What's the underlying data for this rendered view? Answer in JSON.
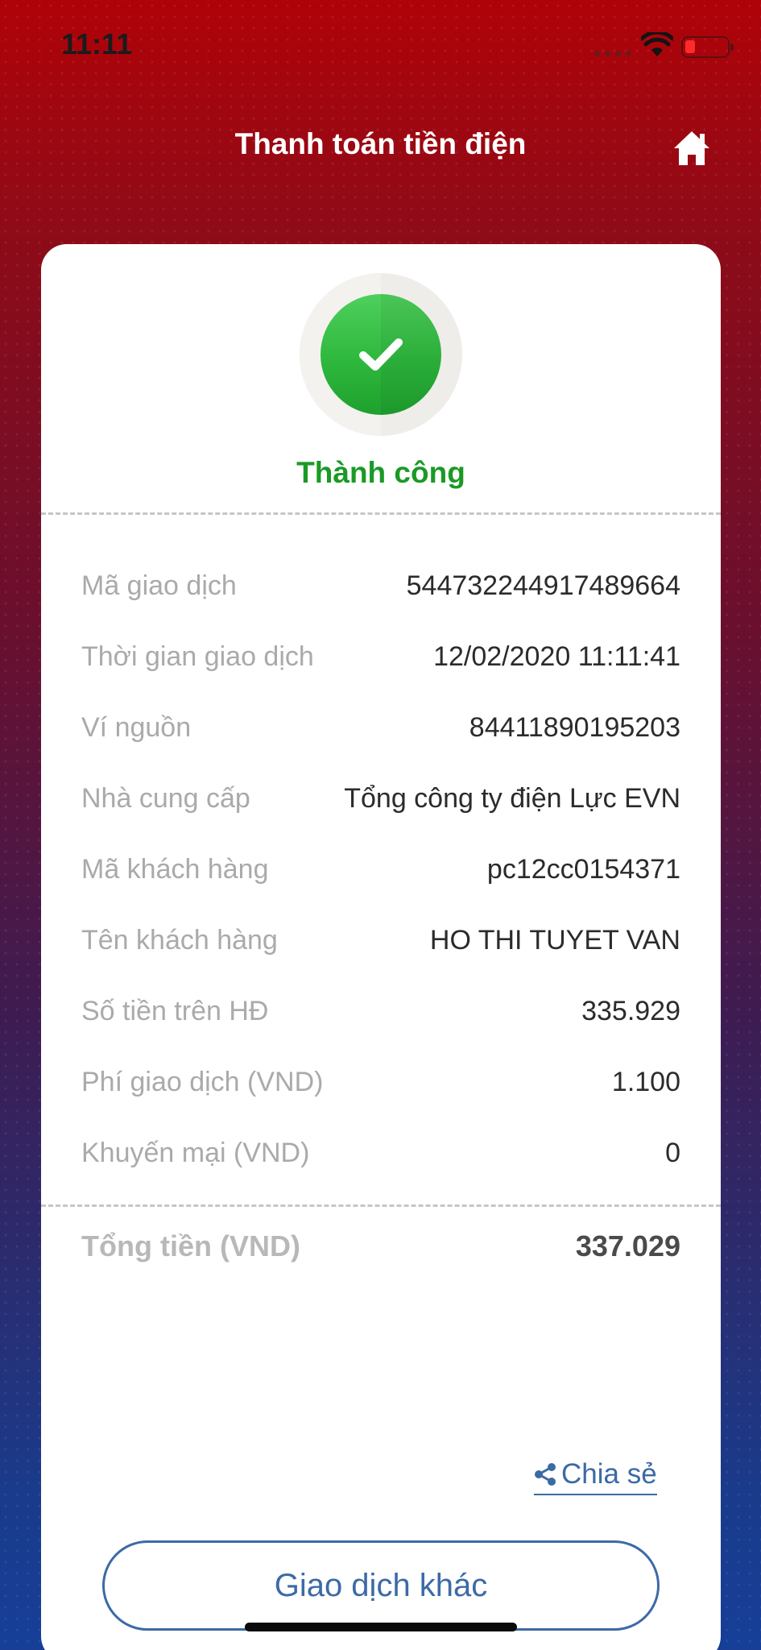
{
  "status_bar": {
    "time": "11:11"
  },
  "header": {
    "title": "Thanh toán tiền điện"
  },
  "result": {
    "status": "Thành công"
  },
  "details": [
    {
      "label": "Mã giao dịch",
      "value": "544732244917489664"
    },
    {
      "label": "Thời gian giao dịch",
      "value": "12/02/2020 11:11:41"
    },
    {
      "label": "Ví nguồn",
      "value": "84411890195203"
    },
    {
      "label": "Nhà cung cấp",
      "value": "Tổng công ty điện Lực EVN"
    },
    {
      "label": "Mã khách hàng",
      "value": "pc12cc0154371"
    },
    {
      "label": "Tên khách hàng",
      "value": "HO THI TUYET VAN"
    },
    {
      "label": "Số tiền trên HĐ",
      "value": "335.929"
    },
    {
      "label": "Phí giao dịch (VND)",
      "value": "1.100"
    },
    {
      "label": "Khuyến mại (VND)",
      "value": "0"
    }
  ],
  "total": {
    "label": "Tổng tiền (VND)",
    "value": "337.029"
  },
  "actions": {
    "share_label": "Chia sẻ",
    "other_transaction_label": "Giao dịch khác"
  },
  "colors": {
    "success": "#1a9a25",
    "link": "#3b6aa4",
    "header_red": "#b00208"
  },
  "icons": {
    "home": "home-icon",
    "check": "check-icon",
    "share": "share-icon"
  }
}
